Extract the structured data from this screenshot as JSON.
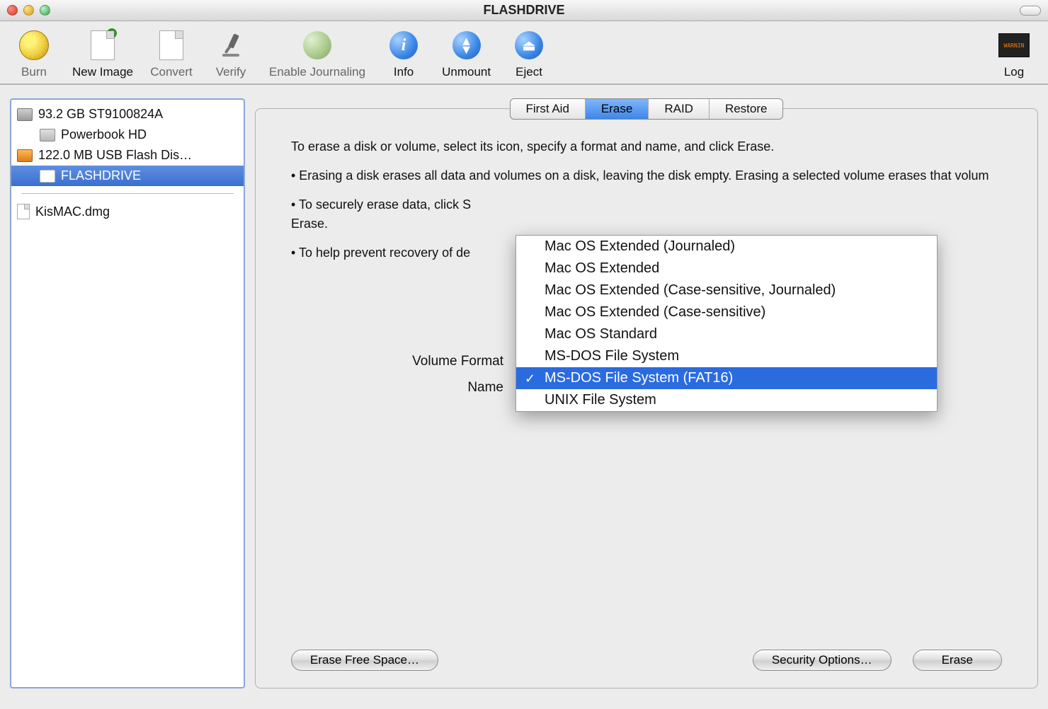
{
  "window": {
    "title": "FLASHDRIVE"
  },
  "toolbar": {
    "burn": "Burn",
    "new_image": "New Image",
    "convert": "Convert",
    "verify": "Verify",
    "journaling": "Enable Journaling",
    "info": "Info",
    "unmount": "Unmount",
    "eject": "Eject",
    "log": "Log"
  },
  "sidebar": {
    "disk0": "93.2 GB ST9100824A",
    "disk0_vol": "Powerbook HD",
    "disk1": "122.0 MB USB Flash Dis…",
    "disk1_vol": "FLASHDRIVE",
    "dmg": "KisMAC.dmg"
  },
  "tabs": {
    "first_aid": "First Aid",
    "erase": "Erase",
    "raid": "RAID",
    "restore": "Restore"
  },
  "panel": {
    "intro": "To erase a disk or volume, select its icon, specify a format and name, and click Erase.",
    "b1": "• Erasing a disk erases all data and volumes on a disk, leaving the disk empty. Erasing a selected volume erases that volum",
    "b2": "• To securely erase data, click S",
    "b2b": "Erase.",
    "b3": "• To help prevent recovery of de",
    "format_label": "Volume Format",
    "name_label": "Name",
    "btn_erase_free": "Erase Free Space…",
    "btn_security": "Security Options…",
    "btn_erase": "Erase"
  },
  "dropdown": {
    "options": [
      "Mac OS Extended (Journaled)",
      "Mac OS Extended",
      "Mac OS Extended (Case-sensitive, Journaled)",
      "Mac OS Extended (Case-sensitive)",
      "Mac OS Standard",
      "MS-DOS File System",
      "MS-DOS File System (FAT16)",
      "UNIX File System"
    ],
    "selected_index": 6
  }
}
